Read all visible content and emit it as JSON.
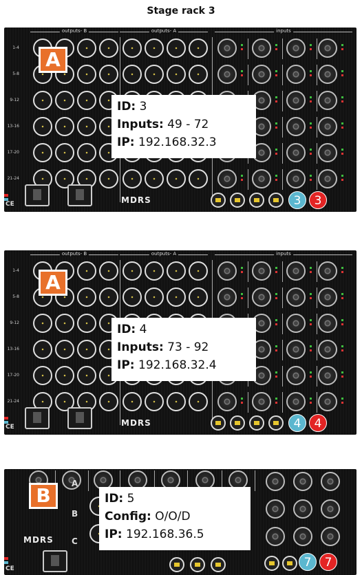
{
  "page": {
    "title": "Stage rack 3"
  },
  "racks": [
    {
      "badge": "A",
      "info": [
        {
          "label": "ID:",
          "value": "3"
        },
        {
          "label": "Inputs:",
          "value": "49 - 72"
        },
        {
          "label": "IP:",
          "value": "192.168.32.3"
        }
      ],
      "indicators": [
        {
          "text": "3",
          "color": "#5bb7cf"
        },
        {
          "text": "3",
          "color": "#e32424"
        }
      ],
      "group_headers": [
        "outputs- B",
        "outputs- A",
        "inputs"
      ],
      "row_labels": [
        "1-4",
        "5-8",
        "9-12",
        "13-16",
        "17-20",
        "21-24"
      ],
      "logo": "MDRS"
    },
    {
      "badge": "A",
      "info": [
        {
          "label": "ID:",
          "value": "4"
        },
        {
          "label": "Inputs:",
          "value": "73 - 92"
        },
        {
          "label": "IP:",
          "value": "192.168.32.4"
        }
      ],
      "indicators": [
        {
          "text": "4",
          "color": "#5bb7cf"
        },
        {
          "text": "4",
          "color": "#e32424"
        }
      ],
      "group_headers": [
        "outputs- B",
        "outputs- A",
        "inputs"
      ],
      "row_labels": [
        "1-4",
        "5-8",
        "9-12",
        "13-16",
        "17-20",
        "21-24"
      ],
      "logo": "MDRS"
    },
    {
      "badge": "B",
      "info": [
        {
          "label": "ID:",
          "value": "5"
        },
        {
          "label": "Config:",
          "value": "O/O/D"
        },
        {
          "label": "IP:",
          "value": "192.168.36.5"
        }
      ],
      "indicators": [
        {
          "text": "7",
          "color": "#5bb7cf"
        },
        {
          "text": "7",
          "color": "#e32424"
        }
      ],
      "row_letters": [
        "A",
        "B",
        "C"
      ],
      "logo": "MDRS"
    }
  ],
  "colors": {
    "badge": "#e8702a",
    "port_blue": "#5bb7cf",
    "port_red": "#e32424",
    "rack_bg": "#111111"
  }
}
